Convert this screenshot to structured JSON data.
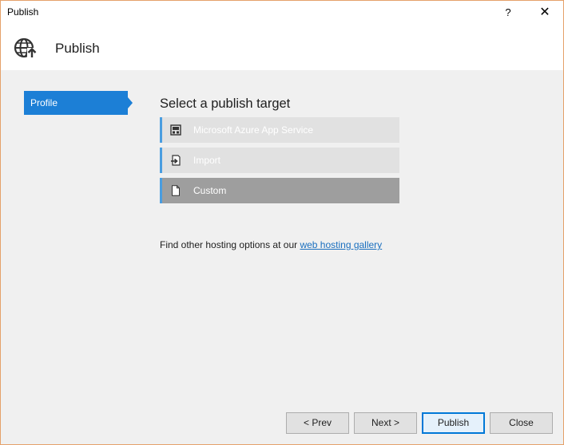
{
  "window": {
    "title": "Publish",
    "help_label": "?",
    "close_label": "✕"
  },
  "header": {
    "title": "Publish",
    "icon": "globe-publish-icon"
  },
  "sidebar": {
    "items": [
      {
        "label": "Profile",
        "selected": true
      }
    ]
  },
  "main": {
    "section_title": "Select a publish target",
    "targets": [
      {
        "label": "Microsoft Azure App Service",
        "icon": "azure-app-service-icon",
        "selected": false
      },
      {
        "label": "Import",
        "icon": "import-icon",
        "selected": false
      },
      {
        "label": "Custom",
        "icon": "document-icon",
        "selected": true
      }
    ],
    "hosting_text": "Find other hosting options at our ",
    "hosting_link": "web hosting gallery"
  },
  "footer": {
    "prev_label": "< Prev",
    "next_label": "Next >",
    "publish_label": "Publish",
    "close_label": "Close"
  },
  "colors": {
    "accent": "#1c7fd6",
    "target_bg": "#e1e1e1",
    "target_selected_bg": "#9e9e9e",
    "link": "#1a6fbf"
  }
}
